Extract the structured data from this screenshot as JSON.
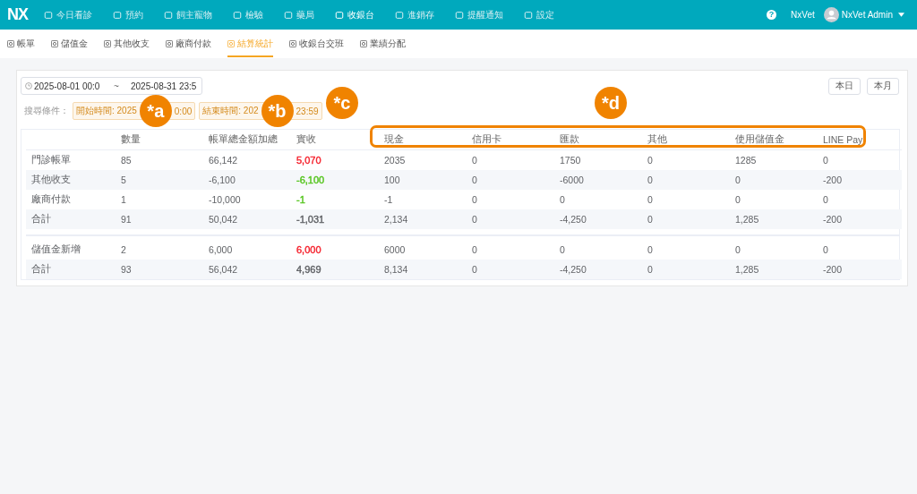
{
  "topbar": {
    "logo": "NX",
    "menu": [
      {
        "label": "今日看診",
        "selected": false
      },
      {
        "label": "預約",
        "selected": false
      },
      {
        "label": "飼主寵物",
        "selected": false
      },
      {
        "label": "檢驗",
        "selected": false
      },
      {
        "label": "藥局",
        "selected": false
      },
      {
        "label": "收銀台",
        "selected": true
      },
      {
        "label": "進銷存",
        "selected": false
      },
      {
        "label": "提醒通知",
        "selected": false
      },
      {
        "label": "設定",
        "selected": false
      }
    ],
    "help": "?",
    "clinic": "NxVet",
    "user": "NxVet Admin"
  },
  "tabs": [
    {
      "label": "帳單",
      "selected": false
    },
    {
      "label": "儲值金",
      "selected": false
    },
    {
      "label": "其他收支",
      "selected": false
    },
    {
      "label": "廠商付款",
      "selected": false
    },
    {
      "label": "結算統計",
      "selected": true
    },
    {
      "label": "收銀台交班",
      "selected": false
    },
    {
      "label": "業績分配",
      "selected": false
    }
  ],
  "filter": {
    "start": "2025-08-01 00:0",
    "separator": "~",
    "end": "2025-08-31 23:5",
    "quick_buttons": [
      "本日",
      "本月"
    ],
    "conditions_label": "搜尋條件：",
    "conditions": [
      {
        "prefix": "開始時間: 2025",
        "suffix": "0:00"
      },
      {
        "prefix": "結束時間: 202",
        "suffix": "23:59"
      }
    ]
  },
  "table": {
    "columns": [
      "",
      "數量",
      "帳單總金額加總",
      "實收",
      "現金",
      "信用卡",
      "匯款",
      "其他",
      "使用儲值金",
      "LINE Pay"
    ],
    "groups": [
      [
        {
          "cells": [
            "門診帳單",
            "85",
            "66,142",
            "5,070",
            "2035",
            "0",
            "1750",
            "0",
            "1285",
            "0"
          ],
          "color": "#f5222d"
        },
        {
          "cells": [
            "其他收支",
            "5",
            "-6,100",
            "-6,100",
            "100",
            "0",
            "-6000",
            "0",
            "0",
            "-200"
          ],
          "color": "#52c41a"
        },
        {
          "cells": [
            "廠商付款",
            "1",
            "-10,000",
            "-1",
            "-1",
            "0",
            "0",
            "0",
            "0",
            "0"
          ],
          "color": "#52c41a"
        },
        {
          "cells": [
            "合計",
            "91",
            "50,042",
            "-1,031",
            "2,134",
            "0",
            "-4,250",
            "0",
            "1,285",
            "-200"
          ],
          "color": "#606266"
        }
      ],
      [
        {
          "cells": [
            "儲值金新增",
            "2",
            "6,000",
            "6,000",
            "6000",
            "0",
            "0",
            "0",
            "0",
            "0"
          ],
          "color": "#f5222d"
        },
        {
          "cells": [
            "合計",
            "93",
            "56,042",
            "4,969",
            "8,134",
            "0",
            "-4,250",
            "0",
            "1,285",
            "-200"
          ],
          "color": "#606266"
        }
      ]
    ]
  },
  "annotations": [
    {
      "label": "*a"
    },
    {
      "label": "*b"
    },
    {
      "label": "*c"
    },
    {
      "label": "*d"
    }
  ]
}
